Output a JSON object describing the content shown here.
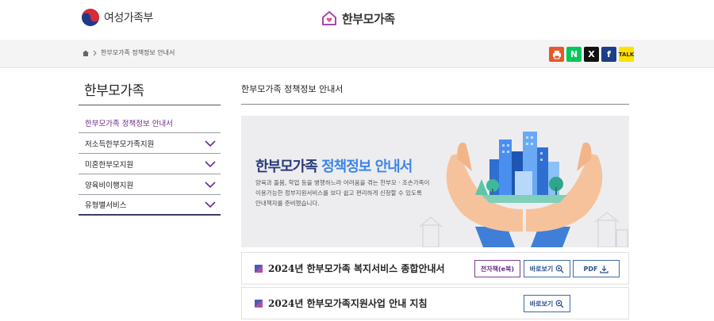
{
  "header": {
    "ministry_name": "여성가족부",
    "site_title": "한부모가족"
  },
  "breadcrumb": {
    "current": "한부모가족 정책정보 안내서"
  },
  "share": {
    "naver_label": "N",
    "x_label": "X",
    "facebook_label": "f",
    "kakao_label": "TALK"
  },
  "sidebar": {
    "title": "한부모가족",
    "items": [
      {
        "label": "한부모가족 정책정보 안내서",
        "active": true
      },
      {
        "label": "저소득한부모가족지원"
      },
      {
        "label": "미혼한부모지원"
      },
      {
        "label": "양육비이행지원"
      },
      {
        "label": "유형별서비스"
      }
    ]
  },
  "main": {
    "title": "한부모가족 정책정보 안내서",
    "banner": {
      "heading_part1": "한부모가족 ",
      "heading_highlight": "정책정보 안내서",
      "line1": "양육과 돌봄, 학업 등을 병행하느라 어려움을 겪는 한부모 · 조손가족이",
      "line2": "이용가능한 정부지원서비스를 보다 쉽고 편리하게 신청할 수 있도록",
      "line3": "안내책자를 준비했습니다."
    },
    "documents": [
      {
        "title": "2024년 한부모가족 복지서비스 종합안내서",
        "ebook_label": "전자책(e북)",
        "view_label": "바로보기",
        "pdf_label": "PDF"
      },
      {
        "title": "2024년 한부모가족지원사업 안내 지침",
        "view_label": "바로보기"
      }
    ]
  },
  "colors": {
    "accent_purple": "#6a2c8e",
    "navy": "#2a3a7a",
    "highlight_blue": "#3f86e8"
  }
}
